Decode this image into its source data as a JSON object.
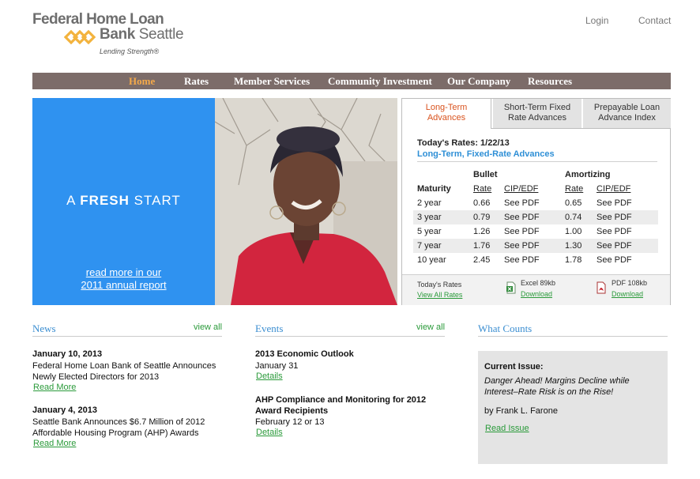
{
  "brand": {
    "line1": "Federal Home Loan",
    "line2_bold": "Bank",
    "line2_rest": " Seattle",
    "tagline": "Lending Strength®",
    "mark_color": "#f3b33d"
  },
  "toplinks": {
    "login": "Login",
    "contact": "Contact"
  },
  "nav": {
    "items": [
      "Home",
      "Rates",
      "Member Services",
      "Community Investment",
      "Our Company",
      "Resources"
    ],
    "active": "Home"
  },
  "hero": {
    "headline_a": "A ",
    "headline_fresh": "FRESH",
    "headline_start": " START",
    "link_line1": "read more in our",
    "link_line2": "2011 annual report",
    "bg_color": "#2f92f0"
  },
  "rates": {
    "tabs": [
      {
        "label1": "Long-Term",
        "label2": "Advances"
      },
      {
        "label1": "Short-Term Fixed",
        "label2": "Rate Advances"
      },
      {
        "label1": "Prepayable Loan",
        "label2": "Advance Index"
      }
    ],
    "date_label": "Today's Rates: 1/22/13",
    "subtitle": "Long-Term, Fixed-Rate Advances",
    "group_bullet": "Bullet",
    "group_amortizing": "Amortizing",
    "col_maturity": "Maturity",
    "col_rate": "Rate",
    "col_cip": "CIP/EDF",
    "rows": [
      {
        "maturity": "2 year",
        "bullet_rate": "0.66",
        "bullet_cip": "See PDF",
        "amort_rate": "0.65",
        "amort_cip": "See PDF"
      },
      {
        "maturity": "3 year",
        "bullet_rate": "0.79",
        "bullet_cip": "See PDF",
        "amort_rate": "0.74",
        "amort_cip": "See PDF"
      },
      {
        "maturity": "5 year",
        "bullet_rate": "1.26",
        "bullet_cip": "See PDF",
        "amort_rate": "1.00",
        "amort_cip": "See PDF"
      },
      {
        "maturity": "7 year",
        "bullet_rate": "1.76",
        "bullet_cip": "See PDF",
        "amort_rate": "1.30",
        "amort_cip": "See PDF"
      },
      {
        "maturity": "10 year",
        "bullet_rate": "2.45",
        "bullet_cip": "See PDF",
        "amort_rate": "1.78",
        "amort_cip": "See PDF"
      }
    ],
    "footer": {
      "todays_rates": "Today's Rates",
      "view_all": "View All Rates",
      "excel_label": "Excel 89kb",
      "excel_link": "Download",
      "pdf_label": "PDF 108kb",
      "pdf_link": "Download"
    }
  },
  "news": {
    "title": "News",
    "view_all": "view all",
    "items": [
      {
        "date": "January 10, 2013",
        "line1": "Federal Home Loan Bank of Seattle Announces",
        "line2": "Newly Elected Directors for 2013",
        "link": "Read More"
      },
      {
        "date": "January 4, 2013",
        "line1": "Seattle Bank Announces $6.7 Million of 2012",
        "line2": "Affordable Housing Program (AHP) Awards",
        "link": "Read More"
      }
    ]
  },
  "events": {
    "title": "Events",
    "view_all": "view all",
    "items": [
      {
        "title1": "2013 Economic Outlook",
        "title2": "",
        "date": "January 31",
        "link": "Details"
      },
      {
        "title1": "AHP Compliance and Monitoring for 2012",
        "title2": "Award Recipients",
        "date": "February 12 or 13",
        "link": "Details"
      }
    ]
  },
  "what_counts": {
    "title": "What Counts",
    "issue_label": "Current Issue:",
    "issue_title": "Danger Ahead! Margins Decline while Interest–Rate Risk is on the Rise!",
    "author": "by Frank L. Farone",
    "link": "Read Issue"
  }
}
